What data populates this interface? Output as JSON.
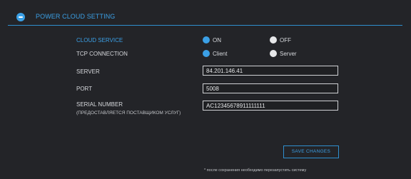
{
  "header": {
    "title": "POWER CLOUD SETTING",
    "icon": "collapse-minus-icon"
  },
  "cloud_service": {
    "label": "CLOUD SERVICE",
    "options": [
      {
        "label": "ON",
        "selected": true
      },
      {
        "label": "OFF",
        "selected": false
      }
    ]
  },
  "tcp_connection": {
    "label": "TCP CONNECTION",
    "options": [
      {
        "label": "Client",
        "selected": true
      },
      {
        "label": "Server",
        "selected": false
      }
    ]
  },
  "server": {
    "label": "SERVER",
    "value": "84.201.146.41"
  },
  "port": {
    "label": "PORT",
    "value": "5008"
  },
  "serial": {
    "label": "SERIAL NUMBER",
    "sublabel": "(ПРЕДОСТАВЛЯЕТСЯ ПОСТАВЩИКОМ УСЛУГ)",
    "value": "AC12345678911111111"
  },
  "save_button": {
    "label": "SAVE CHANGES"
  },
  "note": "* после сохранения необходимо перезапустить систему",
  "colors": {
    "accent": "#3ba0e6",
    "background": "#232428",
    "text": "#d6d8dc"
  }
}
